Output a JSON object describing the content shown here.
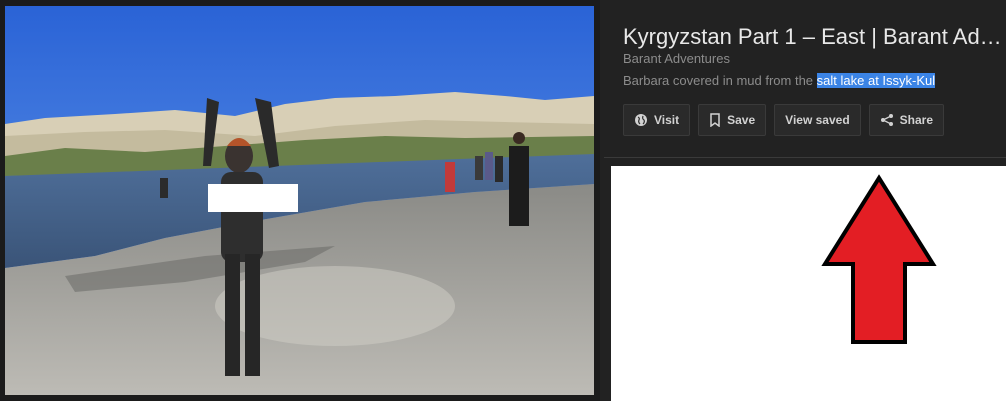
{
  "header": {
    "title": "Kyrgyzstan Part 1 – East | Barant Ad…",
    "source": "Barant Adventures",
    "caption_prefix": "Barbara covered in mud from the ",
    "caption_highlight": "salt lake at Issyk-Kul"
  },
  "actions": {
    "visit": {
      "label": "Visit",
      "icon": "globe-icon"
    },
    "save": {
      "label": "Save",
      "icon": "bookmark-icon"
    },
    "view_saved": {
      "label": "View saved"
    },
    "share": {
      "label": "Share",
      "icon": "share-icon"
    }
  },
  "annotation": {
    "arrow_color": "#e31e24",
    "arrow_outline": "#000000"
  },
  "colors": {
    "panel_bg": "#222222",
    "highlight": "#3b84e6"
  }
}
